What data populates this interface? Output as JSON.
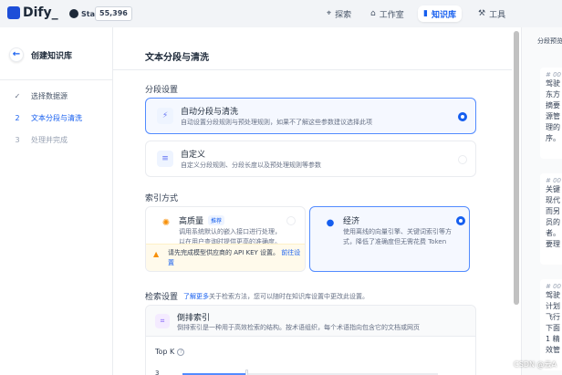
{
  "app": {
    "logo_text": "Dify_",
    "github_star_label": "Star",
    "github_star_count": "55,396"
  },
  "nav": {
    "explore": "探索",
    "studio": "工作室",
    "knowledge": "知识库",
    "tools": "工具",
    "active": "knowledge"
  },
  "steps": {
    "title": "创建知识库",
    "items": [
      {
        "num": "✓",
        "label": "选择数据源",
        "state": "done"
      },
      {
        "num": "2",
        "label": "文本分段与清洗",
        "state": "current"
      },
      {
        "num": "3",
        "label": "处理并完成",
        "state": "todo"
      }
    ]
  },
  "main": {
    "title": "文本分段与清洗",
    "segment_section": "分段设置",
    "auto_option": {
      "title": "自动分段与清洗",
      "desc": "自动设置分段规则与预处理规则，如果不了解这些参数建议选择此项",
      "selected": true
    },
    "custom_option": {
      "title": "自定义",
      "desc": "自定义分段规则、分段长度以及预处理规则等参数",
      "selected": false
    },
    "index_section": "索引方式",
    "high_quality": {
      "title": "高质量",
      "badge": "推荐",
      "desc_line1": "调用系统默认的嵌入接口进行处理，",
      "desc_line2": "以在用户查询时提供更高的准确度。",
      "warning_text": "请先完成模型供应商的 API KEY 设置。",
      "warning_link": "前往设置",
      "selected": false
    },
    "economy": {
      "title": "经济",
      "desc": "使用离线的向量引擎、关键词索引等方式，降低了准确度但无需花费 Token",
      "selected": true
    },
    "retrieval_section": "检索设置",
    "retrieval_more_link": "了解更多",
    "retrieval_more_text": "关于检索方法，您可以随时在知识库设置中更改此设置。",
    "inverted_index": {
      "title": "倒排索引",
      "desc": "倒排索引是一种用于高效检索的结构。按术语组织，每个术语指向包含它的文档或网页"
    },
    "topk_label": "Top K",
    "topk_value": "3"
  },
  "preview": {
    "title": "分段预览",
    "chunks": [
      {
        "tag": "# 00",
        "lines": [
          "驾驶",
          "东方",
          "摘要",
          "源管",
          "理的",
          "序。"
        ]
      },
      {
        "tag": "# 00",
        "lines": [
          "关键",
          "现代",
          "而另",
          "员的",
          "者。",
          "要理"
        ]
      },
      {
        "tag": "# 00",
        "lines": [
          "驾驶",
          "计划",
          "飞行",
          "下面",
          "1 精",
          "效管"
        ]
      }
    ]
  },
  "watermark": "CSDN @云A"
}
